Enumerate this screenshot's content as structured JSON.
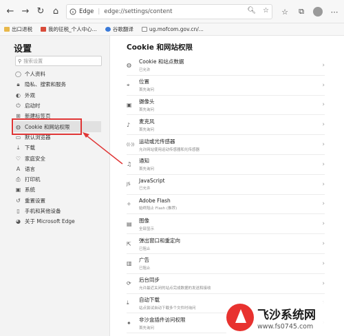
{
  "toolbar": {
    "back": "←",
    "forward": "→",
    "refresh": "↻",
    "home": "⌂",
    "app_name": "Edge",
    "separator": "|",
    "url": "edge://settings/content"
  },
  "bookmarks": [
    {
      "label": "出口退税",
      "icon": "folder-icon"
    },
    {
      "label": "我的征税_个人中心...",
      "icon": "red-doc-icon"
    },
    {
      "label": "谷歌翻译",
      "icon": "translate-icon"
    },
    {
      "label": "ug.mofcom.gov.cn/...",
      "icon": "page-icon"
    }
  ],
  "sidebar": {
    "title": "设置",
    "search_placeholder": "搜索设置",
    "items": [
      {
        "label": "个人资料",
        "icon": "person-icon"
      },
      {
        "label": "隐私、搜索和服务",
        "icon": "lock-icon"
      },
      {
        "label": "外观",
        "icon": "appearance-icon"
      },
      {
        "label": "启动时",
        "icon": "power-icon"
      },
      {
        "label": "新建标签页",
        "icon": "newtab-icon"
      },
      {
        "label": "Cookie 和网站权限",
        "icon": "cookie-icon",
        "active": true
      },
      {
        "label": "默认浏览器",
        "icon": "browser-icon"
      },
      {
        "label": "下载",
        "icon": "download-icon"
      },
      {
        "label": "家庭安全",
        "icon": "family-icon"
      },
      {
        "label": "语言",
        "icon": "language-icon"
      },
      {
        "label": "打印机",
        "icon": "printer-icon"
      },
      {
        "label": "系统",
        "icon": "system-icon"
      },
      {
        "label": "重置设置",
        "icon": "reset-icon"
      },
      {
        "label": "手机和其他设备",
        "icon": "phone-icon"
      },
      {
        "label": "关于 Microsoft Edge",
        "icon": "edge-icon"
      }
    ]
  },
  "main": {
    "title": "Cookie 和网站权限",
    "rows": [
      {
        "label": "Cookie 和站点数据",
        "sub": "已允许",
        "icon": "cookie-icon"
      },
      {
        "label": "位置",
        "sub": "首先询问",
        "icon": "location-icon"
      },
      {
        "label": "摄像头",
        "sub": "首先询问",
        "icon": "camera-icon"
      },
      {
        "label": "麦克风",
        "sub": "首先询问",
        "icon": "microphone-icon"
      },
      {
        "label": "运动或光传感器",
        "sub": "允许网站使用运动传感器和光传感器",
        "icon": "sensor-icon"
      },
      {
        "label": "通知",
        "sub": "首先询问",
        "icon": "bell-icon"
      },
      {
        "label": "JavaScript",
        "sub": "已允许",
        "icon": "javascript-icon"
      },
      {
        "label": "Adobe Flash",
        "sub": "始终阻止 Flash (推荐)",
        "icon": "puzzle-icon"
      },
      {
        "label": "图像",
        "sub": "全部显示",
        "icon": "image-icon"
      },
      {
        "label": "弹出窗口和重定向",
        "sub": "已阻止",
        "icon": "popup-icon"
      },
      {
        "label": "广告",
        "sub": "已阻止",
        "icon": "ads-icon"
      },
      {
        "label": "后台同步",
        "sub": "允许最近关闭的站点完成数据的发送和接收",
        "icon": "sync-icon"
      },
      {
        "label": "自动下载",
        "sub": "站点尝试自动下载多个文件时询问",
        "icon": "download-icon"
      },
      {
        "label": "非沙盒插件访问权限",
        "sub": "首先询问",
        "icon": "plugin-icon"
      }
    ]
  },
  "watermark": {
    "text": "飞沙系统网",
    "url": "www.fs0745.com"
  }
}
